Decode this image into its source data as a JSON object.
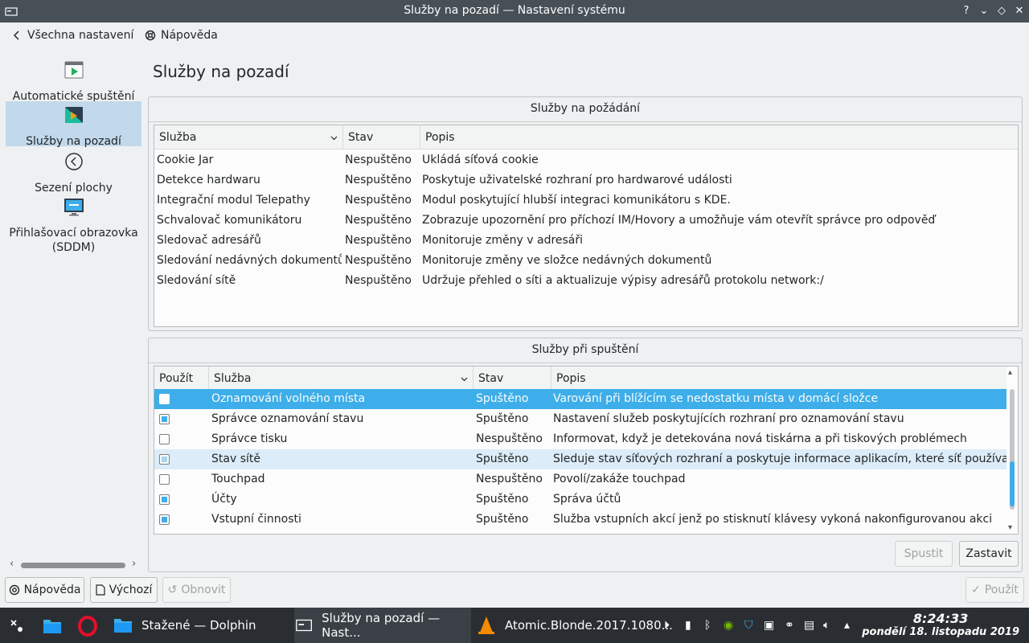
{
  "window": {
    "title": "Služby na pozadí — Nastavení systému",
    "buttons": [
      "?",
      "⌄",
      "◇",
      "✕"
    ]
  },
  "toolbar": {
    "back_label": "Všechna nastavení",
    "help_label": "Nápověda"
  },
  "sidebar": {
    "items": [
      {
        "label": "Automatické spuštění",
        "icon": "autostart-icon"
      },
      {
        "label": "Služby na pozadí",
        "icon": "background-services-icon",
        "selected": true
      },
      {
        "label": "Sezení plochy",
        "icon": "desktop-session-icon"
      },
      {
        "label": "Přihlašovací obrazovka (SDDM)",
        "icon": "login-screen-icon"
      }
    ]
  },
  "page": {
    "title": "Služby na pozadí"
  },
  "on_demand": {
    "title": "Služby na požádání",
    "columns": [
      "Služba",
      "Stav",
      "Popis"
    ],
    "rows": [
      {
        "service": "Cookie Jar",
        "status": "Nespuštěno",
        "desc": "Ukládá síťová cookie"
      },
      {
        "service": "Detekce hardwaru",
        "status": "Nespuštěno",
        "desc": "Poskytuje uživatelské rozhraní pro hardwarové události"
      },
      {
        "service": "Integrační modul Telepathy",
        "status": "Nespuštěno",
        "desc": "Modul poskytující hlubší integraci komunikátoru s KDE."
      },
      {
        "service": "Schvalovač komunikátoru",
        "status": "Nespuštěno",
        "desc": "Zobrazuje upozornění pro příchozí IM/Hovory a umožňuje vám otevřít správce pro odpověď"
      },
      {
        "service": "Sledovač adresářů",
        "status": "Nespuštěno",
        "desc": "Monitoruje změny v adresáři"
      },
      {
        "service": "Sledování nedávných dokumentů",
        "status": "Nespuštěno",
        "desc": "Monitoruje změny ve složce nedávných dokumentů"
      },
      {
        "service": "Sledování sítě",
        "status": "Nespuštěno",
        "desc": "Udržuje přehled o síti a aktualizuje výpisy adresářů protokolu network:/"
      }
    ]
  },
  "startup": {
    "title": "Služby při spuštění",
    "columns": [
      "Použít",
      "Služba",
      "Stav",
      "Popis"
    ],
    "rows": [
      {
        "use": false,
        "service": "Oznamování volného místa",
        "status": "Spuštěno",
        "desc": "Varování při blížícím se nedostatku místa v domácí složce",
        "state": "selected"
      },
      {
        "use": true,
        "service": "Správce oznamování stavu",
        "status": "Spuštěno",
        "desc": "Nastavení služeb poskytujících rozhraní pro oznamování stavu",
        "state": ""
      },
      {
        "use": false,
        "service": "Správce tisku",
        "status": "Nespuštěno",
        "desc": "Informovat, když je detekována nová tiskárna a při tiskových problémech",
        "state": ""
      },
      {
        "use": true,
        "service": "Stav sítě",
        "status": "Spuštěno",
        "desc": "Sleduje stav síťových rozhraní a poskytuje informace aplikacím, které síť používají.",
        "state": "hover"
      },
      {
        "use": false,
        "service": "Touchpad",
        "status": "Nespuštěno",
        "desc": "Povolí/zakáže touchpad",
        "state": ""
      },
      {
        "use": true,
        "service": "Účty",
        "status": "Spuštěno",
        "desc": "Správa účtů",
        "state": ""
      },
      {
        "use": true,
        "service": "Vstupní činnosti",
        "status": "Spuštěno",
        "desc": "Služba vstupních akcí jenž po stisknutí klávesy vykoná nakonfigurovanou akci",
        "state": ""
      }
    ],
    "start_label": "Spustit",
    "stop_label": "Zastavit"
  },
  "actions": {
    "help_label": "Nápověda",
    "defaults_label": "Výchozí",
    "reset_label": "Obnovit",
    "apply_label": "Použít"
  },
  "taskbar": {
    "tasks": [
      {
        "label": "Stažené — Dolphin"
      },
      {
        "label": "Služby na pozadí — Nast..."
      },
      {
        "label": "Atomic.Blonde.2017.1080..."
      }
    ],
    "clock_time": "8:24:33",
    "clock_date": "pondělí 18. listopadu 2019"
  },
  "colors": {
    "accent": "#3daee9",
    "titlebar": "#475057",
    "taskbar": "#2a2e32",
    "selection_light": "#c2d9ec"
  }
}
